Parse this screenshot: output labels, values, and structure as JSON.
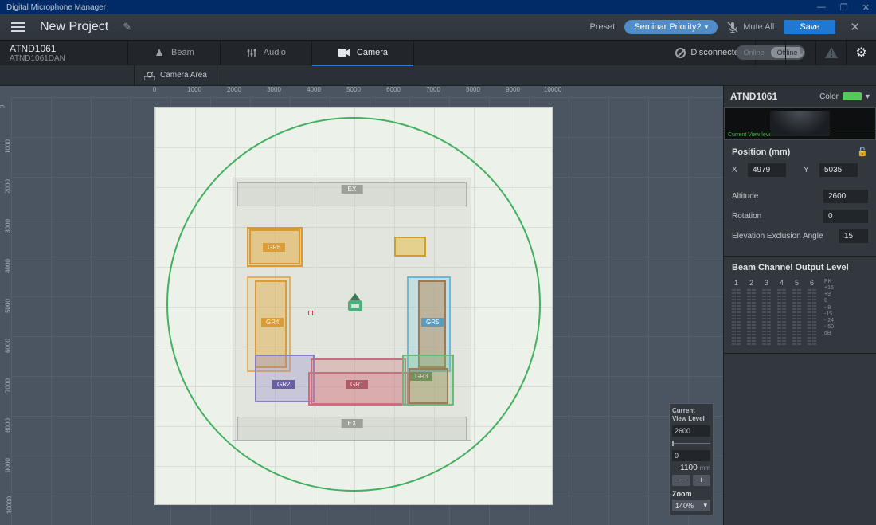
{
  "titlebar": {
    "appTitle": "Digital Microphone Manager"
  },
  "mainbar": {
    "projectName": "New Project",
    "presetLabel": "Preset",
    "presetValue": "Seminar Priority2",
    "muteAll": "Mute All",
    "save": "Save"
  },
  "devicebar": {
    "deviceName": "ATND1061",
    "deviceSub": "ATND1061DAN",
    "tabs": {
      "beam": "Beam",
      "audio": "Audio",
      "camera": "Camera"
    },
    "status": "Disconnected",
    "toggle": {
      "online": "Online",
      "offline": "Offline"
    }
  },
  "subbar": {
    "cameraArea": "Camera Area"
  },
  "ruler": {
    "h": [
      "0",
      "1000",
      "2000",
      "3000",
      "4000",
      "5000",
      "6000",
      "7000",
      "8000",
      "9000",
      "10000"
    ],
    "v": [
      "0",
      "1000",
      "2000",
      "3000",
      "4000",
      "5000",
      "6000",
      "7000",
      "8000",
      "9000",
      "10000"
    ]
  },
  "zones": {
    "ex": "EX",
    "gr1": "GR1",
    "gr2": "GR2",
    "gr3": "GR3",
    "gr4": "GR4",
    "gr5": "GR5",
    "gr6": "GR6"
  },
  "viewPanel": {
    "header": "Current View Level",
    "top": "2600",
    "bottom": "0",
    "width": "1100",
    "unit": "mm",
    "zoomLabel": "Zoom",
    "zoomValue": "140%"
  },
  "rightPanel": {
    "deviceName": "ATND1061",
    "colorLabel": "Color",
    "previewLabel": "Current View level",
    "positionHeader": "Position (mm)",
    "x": {
      "label": "X",
      "value": "4979"
    },
    "y": {
      "label": "Y",
      "value": "5035"
    },
    "altitude": {
      "label": "Altitude",
      "value": "2600"
    },
    "rotation": {
      "label": "Rotation",
      "value": "0"
    },
    "elevation": {
      "label": "Elevation Exclusion Angle",
      "value": "15"
    },
    "beamHeader": "Beam Channel Output Level",
    "channels": [
      "1",
      "2",
      "3",
      "4",
      "5",
      "6"
    ],
    "scale": [
      "PK",
      "+15",
      "+9",
      "0",
      "- 8",
      "-15",
      "- 24",
      "- 50",
      "dB"
    ]
  }
}
